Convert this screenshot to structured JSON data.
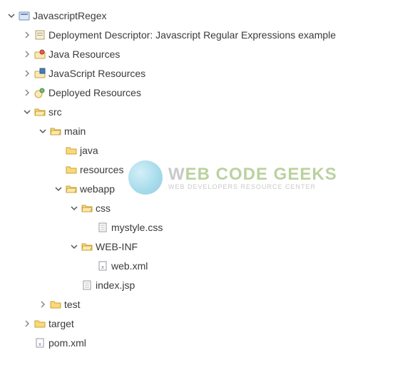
{
  "watermark": {
    "line1_pre": "W",
    "line1_rest": "EB CODE GEEKS",
    "line2": "WEB DEVELOPERS RESOURCE CENTER"
  },
  "tree": [
    {
      "depth": 0,
      "arrow": "open",
      "icon": "project",
      "label": "JavascriptRegex"
    },
    {
      "depth": 1,
      "arrow": "closed",
      "icon": "descriptor",
      "label": "Deployment Descriptor: Javascript Regular Expressions example"
    },
    {
      "depth": 1,
      "arrow": "closed",
      "icon": "java-res",
      "label": "Java Resources"
    },
    {
      "depth": 1,
      "arrow": "closed",
      "icon": "js-res",
      "label": "JavaScript Resources"
    },
    {
      "depth": 1,
      "arrow": "closed",
      "icon": "deployed",
      "label": "Deployed Resources"
    },
    {
      "depth": 1,
      "arrow": "open",
      "icon": "folder-open",
      "label": "src"
    },
    {
      "depth": 2,
      "arrow": "open",
      "icon": "folder-open",
      "label": "main"
    },
    {
      "depth": 3,
      "arrow": "none",
      "icon": "folder-closed",
      "label": "java"
    },
    {
      "depth": 3,
      "arrow": "none",
      "icon": "folder-closed",
      "label": "resources"
    },
    {
      "depth": 3,
      "arrow": "open",
      "icon": "folder-open",
      "label": "webapp"
    },
    {
      "depth": 4,
      "arrow": "open",
      "icon": "folder-open",
      "label": "css"
    },
    {
      "depth": 5,
      "arrow": "none",
      "icon": "file",
      "label": "mystyle.css"
    },
    {
      "depth": 4,
      "arrow": "open",
      "icon": "folder-open",
      "label": "WEB-INF"
    },
    {
      "depth": 5,
      "arrow": "none",
      "icon": "xml-file",
      "label": "web.xml"
    },
    {
      "depth": 4,
      "arrow": "none",
      "icon": "file",
      "label": "index.jsp"
    },
    {
      "depth": 2,
      "arrow": "closed",
      "icon": "folder-closed",
      "label": "test"
    },
    {
      "depth": 1,
      "arrow": "closed",
      "icon": "folder-closed",
      "label": "target"
    },
    {
      "depth": 1,
      "arrow": "none",
      "icon": "xml-file",
      "label": "pom.xml"
    }
  ]
}
